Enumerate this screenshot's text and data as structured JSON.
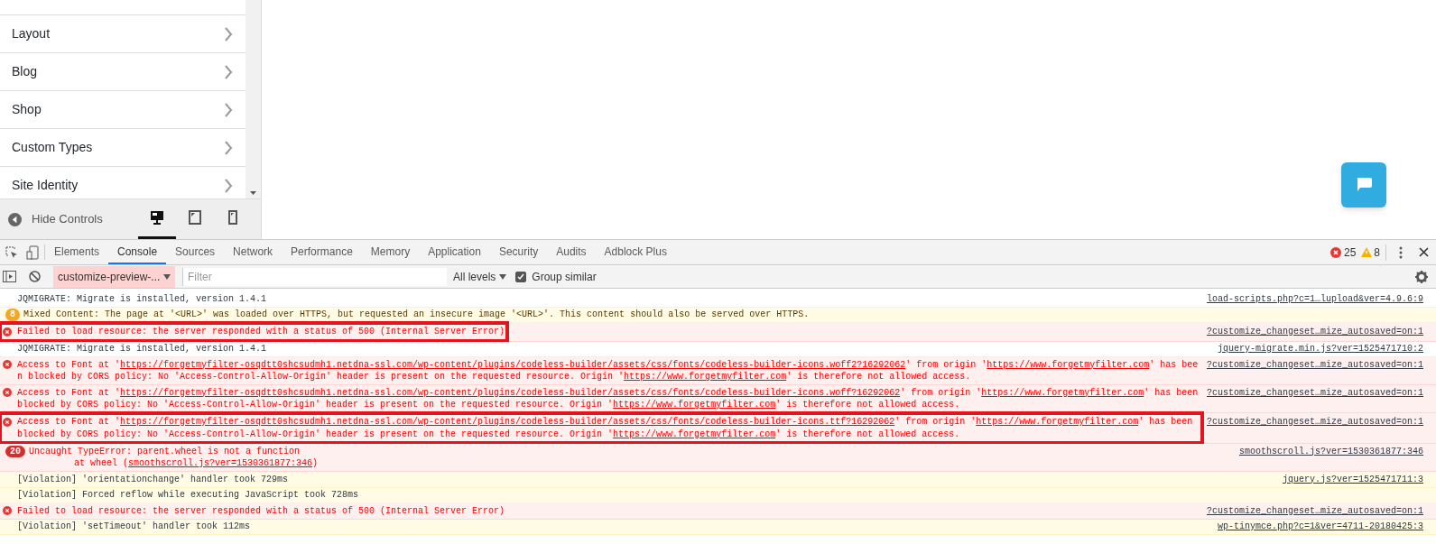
{
  "customizer": {
    "sections": [
      {
        "label": "Layout"
      },
      {
        "label": "Blog"
      },
      {
        "label": "Shop"
      },
      {
        "label": "Custom Types"
      },
      {
        "label": "Site Identity"
      }
    ],
    "hide_controls": "Hide Controls",
    "devices": [
      {
        "kind": "desktop",
        "selected": true
      },
      {
        "kind": "tablet",
        "selected": false
      },
      {
        "kind": "mobile",
        "selected": false
      }
    ]
  },
  "devtools": {
    "tabs": [
      {
        "label": "Elements",
        "selected": false
      },
      {
        "label": "Console",
        "selected": true
      },
      {
        "label": "Sources",
        "selected": false
      },
      {
        "label": "Network",
        "selected": false
      },
      {
        "label": "Performance",
        "selected": false
      },
      {
        "label": "Memory",
        "selected": false
      },
      {
        "label": "Application",
        "selected": false
      },
      {
        "label": "Security",
        "selected": false
      },
      {
        "label": "Audits",
        "selected": false
      },
      {
        "label": "Adblock Plus",
        "selected": false
      }
    ],
    "error_count": "25",
    "warning_count": "8",
    "context": "customize-preview-...",
    "filter": {
      "placeholder": "Filter"
    },
    "levels": "All levels",
    "group_similar": {
      "label": "Group similar",
      "checked": true
    },
    "messages": [
      {
        "kind": "log",
        "parts": [
          {
            "text": "JQMIGRATE: Migrate is installed, version 1.4.1",
            "link": false
          }
        ],
        "source": "load-scripts.php?c=1…lupload&ver=4.9.6:9"
      },
      {
        "kind": "warning",
        "count": "8",
        "parts": [
          {
            "text": "Mixed Content: The page at '<URL>' was loaded over HTTPS, but requested an insecure image '<URL>'. This content should also be served over HTTPS.",
            "link": false
          }
        ]
      },
      {
        "kind": "error",
        "highlighted": true,
        "parts": [
          {
            "text": "Failed to load resource: the server responded with a status of 500 (Internal Server Error)",
            "link": false
          }
        ],
        "source": "?customize_changeset…mize_autosaved=on:1"
      },
      {
        "kind": "log",
        "parts": [
          {
            "text": "JQMIGRATE: Migrate is installed, version 1.4.1",
            "link": false
          }
        ],
        "source": "jquery-migrate.min.js?ver=1525471710:2"
      },
      {
        "kind": "error",
        "parts": [
          {
            "text": "Access to Font at '",
            "link": false
          },
          {
            "text": "https://forgetmyfilter-osqdtt0shcsudmh1.netdna-ssl.com/wp-content/plugins/codeless-builder/assets/css/fonts/codeless-builder-icons.woff2?16292062",
            "link": true
          },
          {
            "text": "' from origin '",
            "link": false
          },
          {
            "text": "https://www.forgetmyfilter.com",
            "link": true
          },
          {
            "text": "' has been blocked by CORS policy: No 'Access-Control-Allow-Origin' header is present on the requested resource. Origin '",
            "link": false
          },
          {
            "text": "https://www.forgetmyfilter.com",
            "link": true
          },
          {
            "text": "' is therefore not allowed access.",
            "link": false
          }
        ],
        "source": "?customize_changeset…mize_autosaved=on:1"
      },
      {
        "kind": "error",
        "parts": [
          {
            "text": "Access to Font at '",
            "link": false
          },
          {
            "text": "https://forgetmyfilter-osqdtt0shcsudmh1.netdna-ssl.com/wp-content/plugins/codeless-builder/assets/css/fonts/codeless-builder-icons.woff?16292062",
            "link": true
          },
          {
            "text": "' from origin '",
            "link": false
          },
          {
            "text": "https://www.forgetmyfilter.com",
            "link": true
          },
          {
            "text": "' has been blocked by CORS policy: No 'Access-Control-Allow-Origin' header is present on the requested resource. Origin '",
            "link": false
          },
          {
            "text": "https://www.forgetmyfilter.com",
            "link": true
          },
          {
            "text": "' is therefore not allowed access.",
            "link": false
          }
        ],
        "source": "?customize_changeset…mize_autosaved=on:1"
      },
      {
        "kind": "error",
        "highlighted": true,
        "parts": [
          {
            "text": "Access to Font at '",
            "link": false
          },
          {
            "text": "https://forgetmyfilter-osqdtt0shcsudmh1.netdna-ssl.com/wp-content/plugins/codeless-builder/assets/css/fonts/codeless-builder-icons.ttf?16292062",
            "link": true
          },
          {
            "text": "' from origin '",
            "link": false
          },
          {
            "text": "https://www.forgetmyfilter.com",
            "link": true
          },
          {
            "text": "' has been blocked by CORS policy: No 'Access-Control-Allow-Origin' header is present on the requested resource. Origin '",
            "link": false
          },
          {
            "text": "https://www.forgetmyfilter.com",
            "link": true
          },
          {
            "text": "' is therefore not allowed access.",
            "link": false
          }
        ],
        "source": "?customize_changeset…mize_autosaved=on:1"
      },
      {
        "kind": "error",
        "count": "20",
        "parts": [
          {
            "text": "Uncaught TypeError: parent.wheel is not a function",
            "link": false
          }
        ],
        "trace": [
          {
            "text": "at wheel (",
            "link": false
          },
          {
            "text": "smoothscroll.js?ver=1530361877:346",
            "link": true
          },
          {
            "text": ")",
            "link": false
          }
        ],
        "source": "smoothscroll.js?ver=1530361877:346"
      },
      {
        "kind": "violation",
        "parts": [
          {
            "text": "[Violation] 'orientationchange' handler took 729ms",
            "link": false
          }
        ],
        "source": "jquery.js?ver=1525471711:3"
      },
      {
        "kind": "violation",
        "parts": [
          {
            "text": "[Violation] Forced reflow while executing JavaScript took 728ms",
            "link": false
          }
        ]
      },
      {
        "kind": "error",
        "parts": [
          {
            "text": "Failed to load resource: the server responded with a status of 500 (Internal Server Error)",
            "link": false
          }
        ],
        "source": "?customize_changeset…mize_autosaved=on:1"
      },
      {
        "kind": "violation",
        "parts": [
          {
            "text": "[Violation] 'setTimeout' handler took 112ms",
            "link": false
          }
        ],
        "source": "wp-tinymce.php?c=1&ver=4711-20180425:3"
      }
    ]
  }
}
